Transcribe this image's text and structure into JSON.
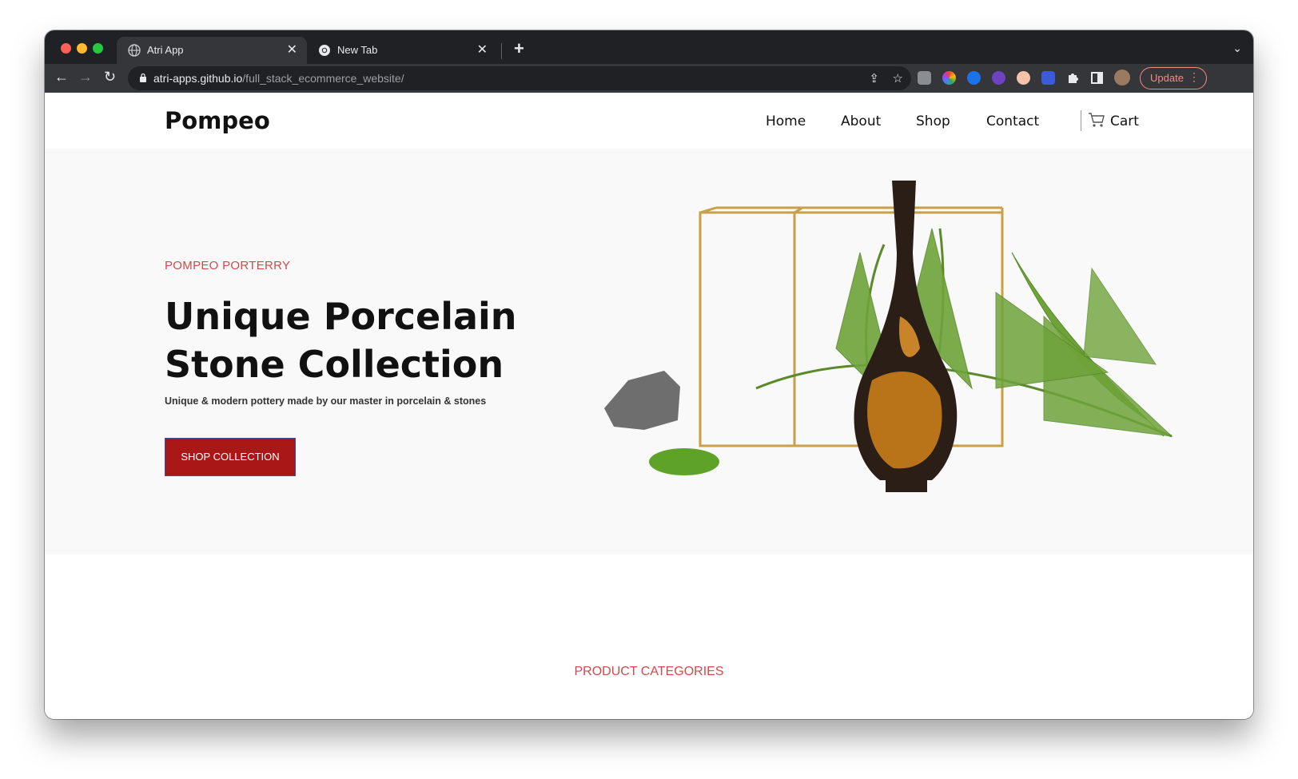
{
  "browser": {
    "tabs": [
      {
        "title": "Atri App",
        "active": true
      },
      {
        "title": "New Tab",
        "active": false
      }
    ],
    "close_glyph": "✕",
    "new_tab_glyph": "+",
    "tab_search_glyph": "⌄",
    "url_host": "atri-apps.github.io",
    "url_path": "/full_stack_ecommerce_website/",
    "update_label": "Update",
    "menu_glyph": "⋮",
    "back_glyph": "←",
    "forward_glyph": "→",
    "reload_glyph": "↻",
    "share_glyph": "⇪",
    "star_glyph": "☆",
    "extension_icons": [
      "ext-grey-icon",
      "ext-colorwheel-icon",
      "ext-blue-drop-icon",
      "ext-purple-icon",
      "ext-face-icon",
      "ext-blue-shape-icon",
      "puzzle-icon",
      "sidepanel-icon",
      "profile-avatar"
    ]
  },
  "site": {
    "logo": "Pompeo",
    "nav": [
      "Home",
      "About",
      "Shop",
      "Contact"
    ],
    "cart_label": "Cart"
  },
  "hero": {
    "eyebrow": "POMPEO PORTERRY",
    "title": "Unique Porcelain Stone Collection",
    "subtitle": "Unique & modern pottery made by our master in porcelain & stones",
    "cta_label": "SHOP COLLECTION"
  },
  "sections": {
    "categories_heading": "PRODUCT CATEGORIES"
  },
  "colors": {
    "accent": "#cd4b4b",
    "cta_bg": "#a91717",
    "cta_border": "#3250a8",
    "hero_bg": "#f9f9f9",
    "browser_dark": "#202124",
    "browser_toolbar": "#35363a"
  }
}
